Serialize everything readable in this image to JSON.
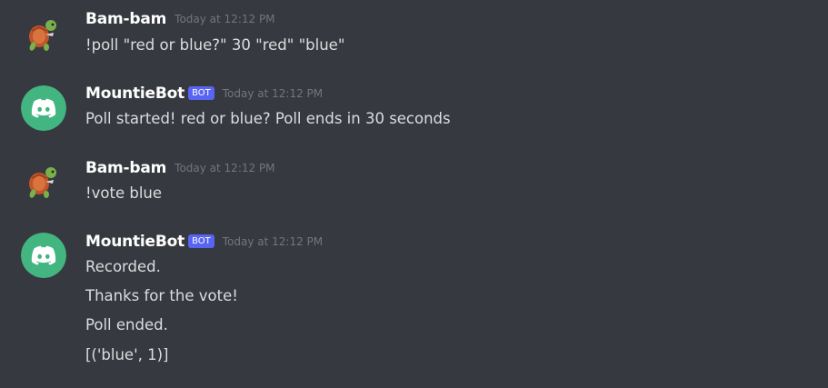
{
  "messages": [
    {
      "author": "Bam-bam",
      "avatar_icon": "turtle-icon",
      "is_bot": false,
      "timestamp": "Today at 12:12 PM",
      "lines": [
        "!poll \"red or blue?\" 30 \"red\" \"blue\""
      ]
    },
    {
      "author": "MountieBot",
      "avatar_icon": "discord-logo-icon",
      "is_bot": true,
      "bot_tag": "BOT",
      "timestamp": "Today at 12:12 PM",
      "lines": [
        "Poll started! red or blue? Poll ends in 30 seconds"
      ]
    },
    {
      "author": "Bam-bam",
      "avatar_icon": "turtle-icon",
      "is_bot": false,
      "timestamp": "Today at 12:12 PM",
      "lines": [
        "!vote blue"
      ]
    },
    {
      "author": "MountieBot",
      "avatar_icon": "discord-logo-icon",
      "is_bot": true,
      "bot_tag": "BOT",
      "timestamp": "Today at 12:12 PM",
      "lines": [
        "Recorded.",
        "Thanks for the vote!",
        "Poll ended.",
        "[('blue', 1)]"
      ]
    }
  ],
  "colors": {
    "background": "#36393f",
    "username": "#ffffff",
    "message_text": "#dcddde",
    "timestamp": "#72767d",
    "bot_tag": "#5865f2",
    "bot_avatar": "#43b581"
  }
}
